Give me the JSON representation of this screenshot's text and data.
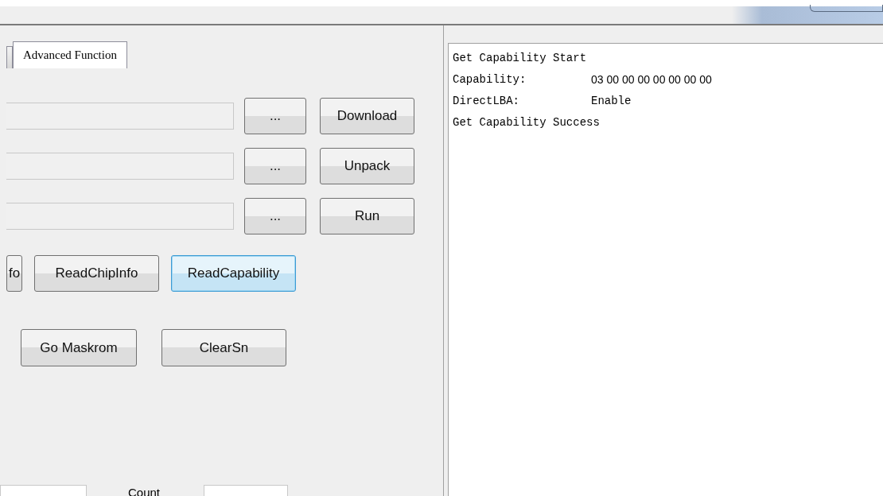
{
  "tabs": [
    {
      "selected": false
    },
    {
      "label": "Advanced Function",
      "selected": true
    }
  ],
  "file_rows": [
    {
      "browse": "...",
      "action": "Download"
    },
    {
      "browse": "...",
      "action": "Unpack"
    },
    {
      "browse": "...",
      "action": "Run"
    }
  ],
  "read_buttons": [
    {
      "label": "fo",
      "focused": false
    },
    {
      "label": "ReadChipInfo",
      "focused": false
    },
    {
      "label": "ReadCapability",
      "focused": true
    }
  ],
  "device_buttons": [
    "Go Maskrom",
    "ClearSn"
  ],
  "count_label": "Count",
  "log": [
    {
      "text": "Get Capability Start"
    },
    {
      "label": "Capability:",
      "value": "03 00 00 00 00 00 00 00",
      "kind": "hex"
    },
    {
      "label": "DirectLBA:",
      "value": "Enable",
      "kind": "word"
    },
    {
      "text": "Get Capability Success"
    }
  ]
}
